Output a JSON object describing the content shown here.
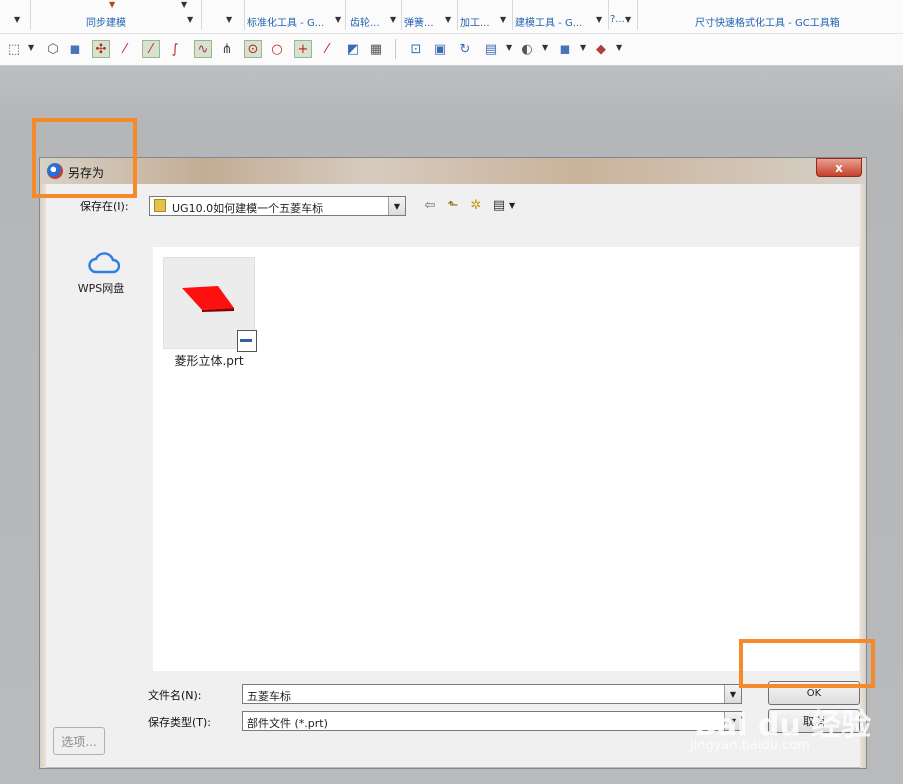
{
  "ribbon": {
    "groups": [
      {
        "label": "同步建模"
      },
      {
        "label": "标准化工具 - G..."
      },
      {
        "label": "齿轮..."
      },
      {
        "label": "弹簧..."
      },
      {
        "label": "加工..."
      },
      {
        "label": "建模工具 - G..."
      },
      {
        "label": "?..."
      },
      {
        "label": "尺寸快速格式化工具 - GC工具箱"
      }
    ]
  },
  "toolbar": {
    "icons": [
      "select-rectangle-icon",
      "box-icon",
      "block-icon",
      "point-snap-icon",
      "line-icon",
      "line-end-icon",
      "curve-icon",
      "spline-icon",
      "intersect-icon",
      "circle-center-icon",
      "circle-icon",
      "cross-icon",
      "diagonal-icon",
      "sheet-icon",
      "grid-icon",
      "fit-view-icon",
      "refresh-view-icon",
      "rotate-icon",
      "layout-icon",
      "shade-icon",
      "cube-icon",
      "render-icon"
    ]
  },
  "dialog": {
    "title": "另存为",
    "close_label": "x",
    "save_in_label": "保存在(I):",
    "save_in_value": "UG10.0如何建模一个五菱车标",
    "places": [
      {
        "label": "WPS网盘",
        "icon": "cloud-icon"
      }
    ],
    "files": [
      {
        "name": "菱形立体.prt",
        "icon": "prt-file-icon"
      }
    ],
    "filename_label": "文件名(N):",
    "filename_value": "五菱车标",
    "filetype_label": "保存类型(T):",
    "filetype_value": "部件文件 (*.prt)",
    "ok_label": "OK",
    "cancel_label": "取消",
    "options_label": "选项..."
  },
  "watermark": {
    "brand": "Bai du 经验",
    "url": "jingyan.baidu.com"
  },
  "colors": {
    "highlight": "#f48a2a",
    "link_blue": "#1f62b3",
    "shape_red": "#ff1010"
  }
}
